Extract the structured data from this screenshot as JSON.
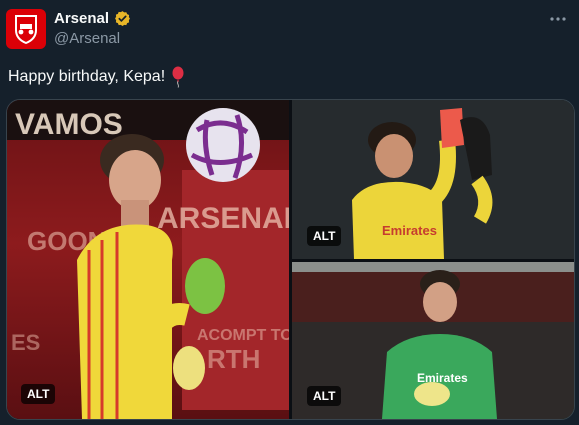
{
  "tweet": {
    "display_name": "Arsenal",
    "handle": "@Arsenal",
    "text": "Happy birthday, Kepa!",
    "emoji": "balloon",
    "verified": true,
    "brand_color": "#db0007",
    "verified_color": "#e8b628"
  },
  "media": {
    "alt_labels": [
      "ALT",
      "ALT",
      "ALT"
    ],
    "photo1_banner_texts": [
      "VAMOS",
      "ARSENAL",
      "GOON",
      "ACOMPT TO",
      "RTH",
      "ES"
    ],
    "photo2_shirt_text": "Emirates",
    "photo3_shirt_text": "Emirates"
  },
  "icons": {
    "avatar": "arsenal-crest",
    "verified": "verified-badge",
    "more": "more-options"
  }
}
